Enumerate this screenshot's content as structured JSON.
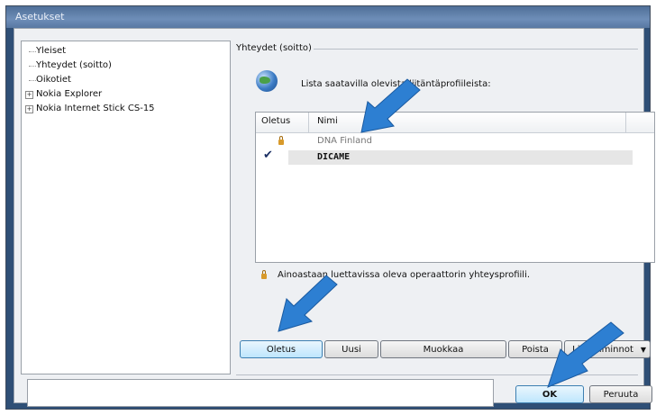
{
  "window": {
    "title": "Asetukset"
  },
  "tree": {
    "items": [
      {
        "label": "Yleiset",
        "expander": ""
      },
      {
        "label": "Yhteydet (soitto)",
        "expander": ""
      },
      {
        "label": "Oikotiet",
        "expander": ""
      },
      {
        "label": "Nokia Explorer",
        "expander": "+"
      },
      {
        "label": "Nokia Internet Stick CS-15",
        "expander": "+"
      }
    ]
  },
  "group": {
    "title": "Yhteydet (soitto)"
  },
  "list": {
    "caption": "Lista saatavilla olevista liitäntäprofiileista:",
    "columns": [
      "Oletus",
      "Nimi"
    ],
    "rows": [
      {
        "name": "DNA Finland",
        "default": false,
        "operator_only": true
      },
      {
        "name": "DICAME",
        "default": true,
        "operator_only": false
      }
    ]
  },
  "note": {
    "text": "Ainoastaan luettavissa oleva operaattorin yhteysprofiili."
  },
  "buttons": {
    "default": "Oletus",
    "new": "Uusi",
    "edit": "Muokkaa",
    "delete": "Poista",
    "more": "Lisätoiminnot",
    "ok": "OK",
    "cancel": "Peruuta"
  },
  "icons": {
    "globe": "globe-icon",
    "lock": "lock-icon",
    "check": "checkmark-icon",
    "dropdown": "dropdown-arrow-icon",
    "annotation_arrow": "blue-arrow-annotation"
  },
  "colors": {
    "arrow": "#2d7fd2",
    "titlebar": "#5878a3"
  }
}
